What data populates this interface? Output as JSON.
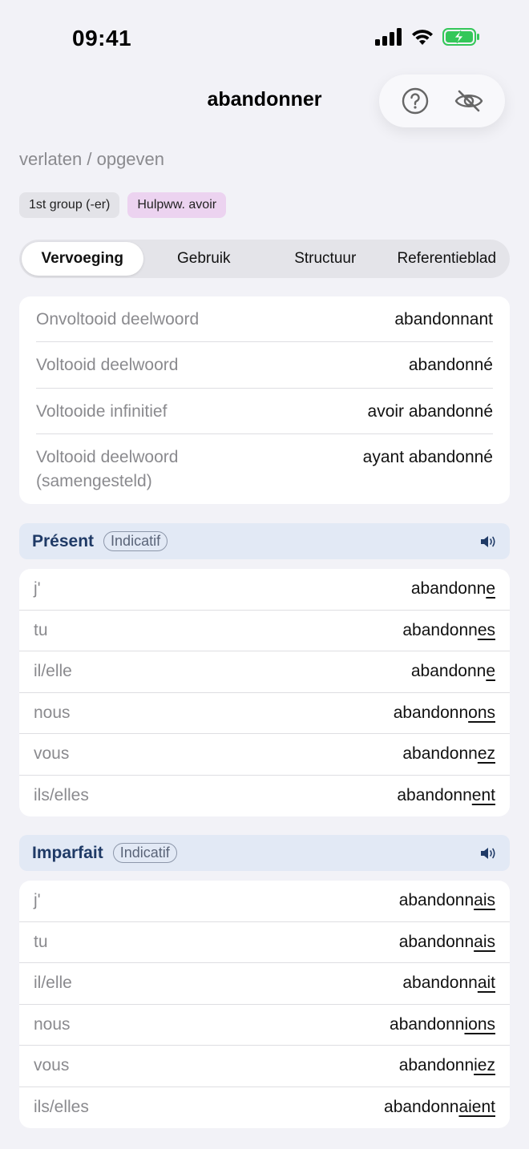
{
  "status_bar": {
    "time": "09:41"
  },
  "nav": {
    "title": "abandonner",
    "help_icon": "question-circle-icon",
    "hide_icon": "eye-slash-icon"
  },
  "translation": "verlaten / opgeven",
  "badges": {
    "group": "1st group (-er)",
    "auxiliary": "Hulpww. avoir"
  },
  "tabs": [
    {
      "label": "Vervoeging",
      "active": true
    },
    {
      "label": "Gebruik",
      "active": false
    },
    {
      "label": "Structuur",
      "active": false
    },
    {
      "label": "Referentieblad",
      "active": false
    }
  ],
  "participles": [
    {
      "label": "Onvoltooid deelwoord",
      "value": "abandonnant"
    },
    {
      "label": "Voltooid deelwoord",
      "value": "abandonné"
    },
    {
      "label": "Voltooide infinitief",
      "value": "avoir abandonné"
    },
    {
      "label": "Voltooid deelwoord (samengesteld)",
      "value": "ayant abandonné"
    }
  ],
  "tenses": [
    {
      "name": "Présent",
      "mood": "Indicatif",
      "rows": [
        {
          "pronoun": "j'",
          "stem": "abandonn",
          "ending": "e"
        },
        {
          "pronoun": "tu",
          "stem": "abandonn",
          "ending": "es"
        },
        {
          "pronoun": "il/elle",
          "stem": "abandonn",
          "ending": "e"
        },
        {
          "pronoun": "nous",
          "stem": "abandonn",
          "ending": "ons"
        },
        {
          "pronoun": "vous",
          "stem": "abandonn",
          "ending": "ez"
        },
        {
          "pronoun": "ils/elles",
          "stem": "abandonn",
          "ending": "ent"
        }
      ]
    },
    {
      "name": "Imparfait",
      "mood": "Indicatif",
      "rows": [
        {
          "pronoun": "j'",
          "stem": "abandonn",
          "ending": "ais"
        },
        {
          "pronoun": "tu",
          "stem": "abandonn",
          "ending": "ais"
        },
        {
          "pronoun": "il/elle",
          "stem": "abandonn",
          "ending": "ait"
        },
        {
          "pronoun": "nous",
          "stem": "abandonn",
          "ending": "ions"
        },
        {
          "pronoun": "vous",
          "stem": "abandonn",
          "ending": "iez"
        },
        {
          "pronoun": "ils/elles",
          "stem": "abandonn",
          "ending": "aient"
        }
      ]
    }
  ],
  "colors": {
    "background": "#f2f2f7",
    "tense_header_bg": "#e2e9f5",
    "tense_title": "#1f3a66",
    "auxiliary_badge": "#ecd3f0",
    "battery": "#34c759"
  }
}
